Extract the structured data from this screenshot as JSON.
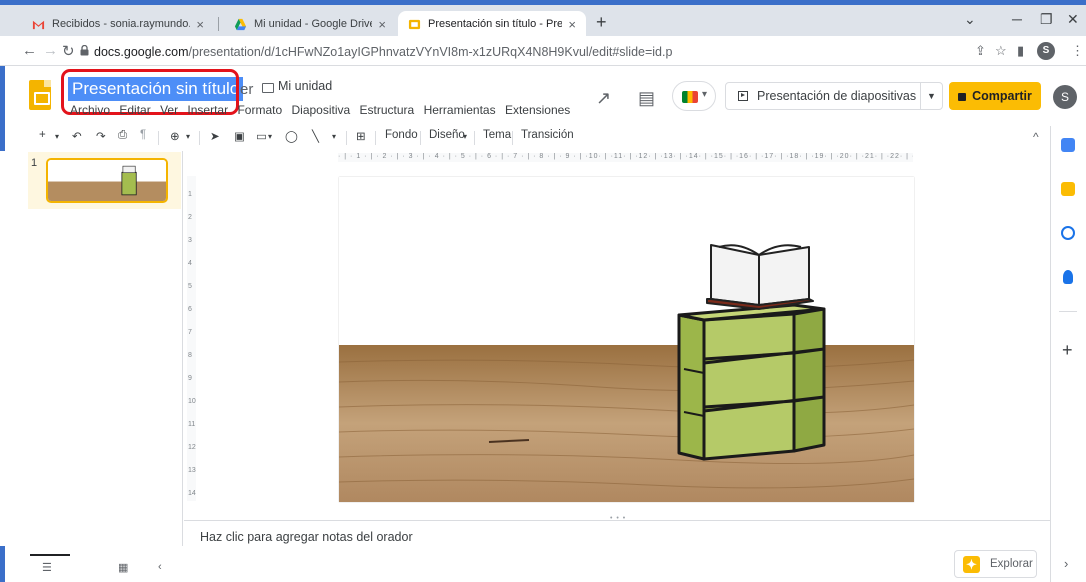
{
  "browser": {
    "tabs": [
      {
        "title": "Recibidos - sonia.raymundo.arr",
        "close": "×"
      },
      {
        "title": "Mi unidad - Google Drive",
        "close": "×"
      },
      {
        "title": "Presentación sin título - Presenta",
        "close": "×"
      }
    ],
    "new_tab": "+",
    "url_domain": "docs.google.com",
    "url_path": "/presentation/d/1cHFwNZo1ayIGPhnvatzVYnVI8m-x1zURqX4N8H9Kvul/edit#slide=id.p",
    "profile_initial": "S"
  },
  "doc": {
    "title": "Presentación sin título",
    "title_suffix": "er",
    "folder": "Mi unidad"
  },
  "menu": [
    "Archivo",
    "Editar",
    "Ver",
    "Insertar",
    "Formato",
    "Diapositiva",
    "Estructura",
    "Herramientas",
    "Extensiones"
  ],
  "header": {
    "present_label": "Presentación de diapositivas",
    "share_label": "Compartir",
    "user_initial": "S"
  },
  "toolbar": {
    "fondo": "Fondo",
    "diseno": "Diseño",
    "tema": "Tema",
    "transicion": "Transición"
  },
  "filmstrip": {
    "slide_number": "1"
  },
  "ruler": {
    "h": "· | · 1 · | · 2 · | · 3 · | · 4 · | · 5 · | · 6 · | · 7 · | · 8 · | · 9 · | ·10· | ·11· | ·12· | ·13· | ·14· | ·15· | ·16· | ·17· | ·18· | ·19· | ·20· | ·21· | ·22· | ·23· | ·24· | ·25·",
    "v": [
      "1",
      "2",
      "3",
      "4",
      "5",
      "6",
      "7",
      "8",
      "9",
      "10",
      "11",
      "12",
      "13",
      "14"
    ]
  },
  "notes": {
    "placeholder": "Haz clic para agregar notas del orador"
  },
  "explore": {
    "label": "Explorar"
  },
  "colors": {
    "accent": "#fbbc04",
    "selection": "#4d8ef7",
    "highlight_border": "#e3131b",
    "slides_yellow": "#f4b400"
  },
  "icons": {
    "side_panel": [
      "calendar-icon",
      "keep-icon",
      "tasks-icon",
      "contacts-icon",
      "plus-icon"
    ]
  }
}
